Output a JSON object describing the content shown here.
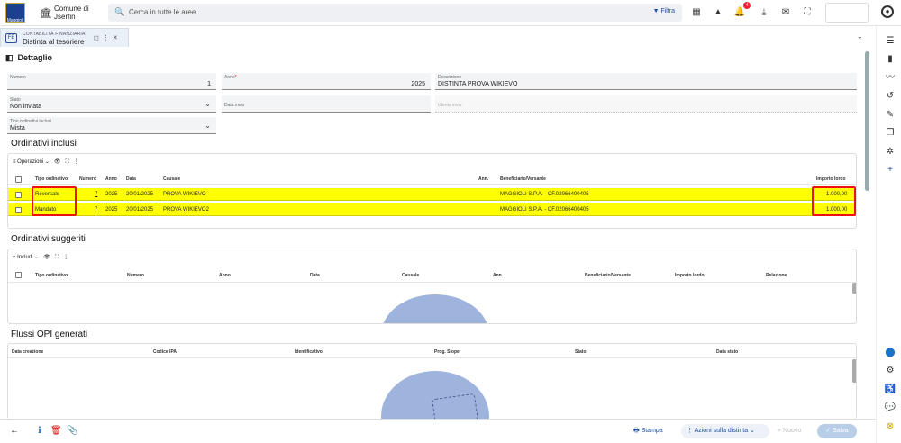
{
  "header": {
    "comune_line1": "Comune di",
    "comune_line2": "Jserfin",
    "search_placeholder": "Cerca in tutte le aree...",
    "filter_label": "Filtra",
    "notification_count": "4"
  },
  "tab": {
    "module": "CONTABILITÀ FINANZIARIA",
    "title": "Distinta al tesoriere",
    "icon_text": "FB"
  },
  "section_title": "Dettaglio",
  "form": {
    "numero": {
      "label": "Numero",
      "value": "1"
    },
    "anno": {
      "label": "Anno",
      "required_mark": "*",
      "value": "2025"
    },
    "descrizione": {
      "label": "Descrizione",
      "value": "DISTINTA PROVA WIKIEVO"
    },
    "stato": {
      "label": "Stato",
      "value": "Non inviata"
    },
    "data_invio": {
      "label": "Data invio"
    },
    "utente_invio": {
      "label": "Utente invio"
    },
    "tipo_ordinativi": {
      "label": "Tipo ordinativi inclusi",
      "value": "Mista"
    }
  },
  "inclusi": {
    "title": "Ordinativi inclusi",
    "toolbar_label": "Operazioni",
    "columns": [
      "Tipo ordinativo",
      "Numero",
      "Anno",
      "Data",
      "Causale",
      "Ann.",
      "Beneficiario/Versante",
      "Importo lordo"
    ],
    "rows": [
      {
        "tipo": "Reversale",
        "numero": "7",
        "anno": "2025",
        "data": "20/01/2025",
        "causale": "PROVA WIKIEVO",
        "ann": "",
        "beneficiario": "MAGGIOLI S.P.A. - CF.02066400405",
        "importo": "1.000,00"
      },
      {
        "tipo": "Mandato",
        "numero": "7",
        "anno": "2025",
        "data": "20/01/2025",
        "causale": "PROVA WIKIEVO2",
        "ann": "",
        "beneficiario": "MAGGIOLI S.P.A. - CF.02066400405",
        "importo": "1.000,00"
      }
    ]
  },
  "suggeriti": {
    "title": "Ordinativi suggeriti",
    "toolbar_label": "Includi",
    "columns": [
      "Tipo ordinativo",
      "Numero",
      "Anno",
      "Data",
      "Causale",
      "Ann.",
      "Beneficiario/Versante",
      "Importo lordo",
      "Relazione"
    ]
  },
  "flussi": {
    "title": "Flussi OPI generati",
    "columns": [
      "Data creazione",
      "Codice IPA",
      "Identificativo",
      "Prog. Siope",
      "Stato",
      "Data stato"
    ]
  },
  "footer": {
    "stampa": "Stampa",
    "azioni": "Azioni sulla distinta",
    "nuovo": "Nuovo",
    "salva": "Salva"
  },
  "colors": {
    "highlight": "#ffff00",
    "annotation_red": "#ee1111",
    "accent_blue": "#1f4fa0"
  }
}
